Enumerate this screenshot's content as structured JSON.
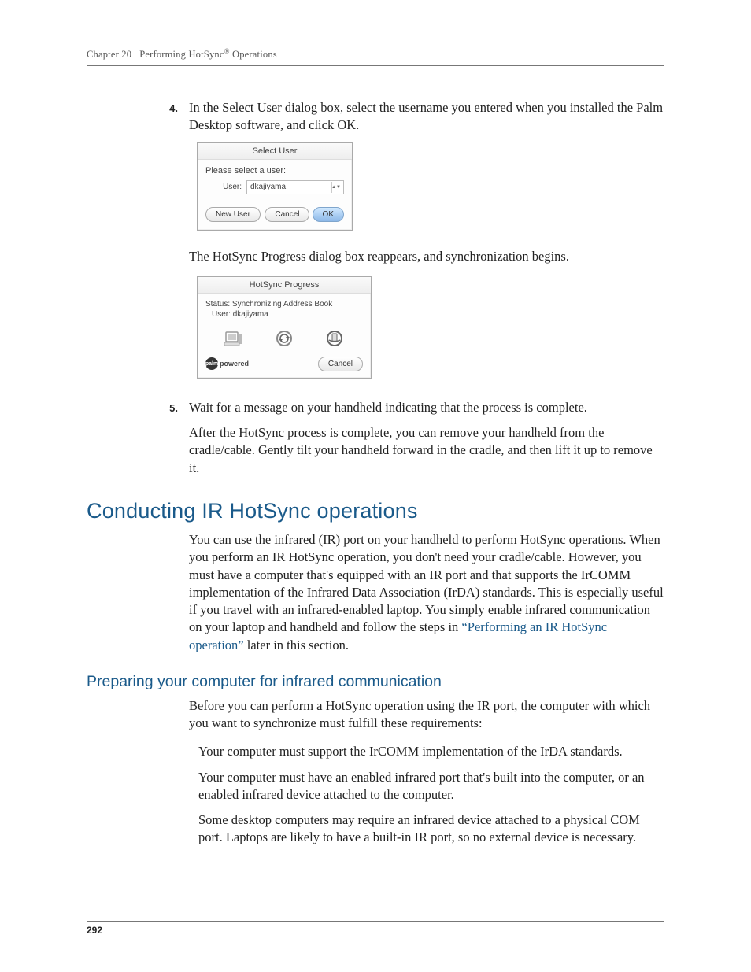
{
  "header": {
    "chapter_label": "Chapter 20",
    "chapter_title": "Performing HotSync",
    "chapter_title_suffix": " Operations"
  },
  "step4": {
    "number": "4.",
    "text": "In the Select User dialog box, select the username you entered when you installed the Palm Desktop software, and click OK."
  },
  "select_user_dialog": {
    "title": "Select User",
    "prompt": "Please select a user:",
    "user_label": "User:",
    "user_value": "dkajiyama",
    "new_user_btn": "New User",
    "cancel_btn": "Cancel",
    "ok_btn": "OK"
  },
  "after_select_user": "The HotSync Progress dialog box reappears, and synchronization begins.",
  "hotsync_dialog": {
    "title": "HotSync Progress",
    "status_label": "Status:",
    "status_value": "Synchronizing Address Book",
    "user_label": "User:",
    "user_value": "dkajiyama",
    "powered_text": "powered",
    "palm_text": "palm",
    "cancel_btn": "Cancel"
  },
  "step5": {
    "number": "5.",
    "text": "Wait for a message on your handheld indicating that the process is complete.",
    "followup": "After the HotSync process is complete, you can remove your handheld from the cradle/cable. Gently tilt your handheld forward in the cradle, and then lift it up to remove it."
  },
  "section_heading": "Conducting IR HotSync operations",
  "section_para_before_link": "You can use the infrared (IR) port on your handheld to perform HotSync operations. When you perform an IR HotSync operation, you don't need your cradle/cable. However, you must have a computer that's equipped with an IR port and that supports the IrCOMM implementation of the Infrared Data Association (IrDA) standards. This is especially useful if you travel with an infrared-enabled laptop. You simply enable infrared communication on your laptop and handheld and follow the steps in ",
  "section_link_text": "“Performing an IR HotSync operation”",
  "section_para_after_link": " later in this section.",
  "subsection_heading": "Preparing your computer for infrared communication",
  "subsection_intro": "Before you can perform a HotSync operation using the IR port, the computer with which you want to synchronize must fulfill these requirements:",
  "requirements": [
    "Your computer must support the IrCOMM implementation of the IrDA standards.",
    "Your computer must have an enabled infrared port that's built into the computer, or an enabled infrared device attached to the computer.",
    "Some desktop computers may require an infrared device attached to a physical COM port. Laptops are likely to have a built-in IR port, so no external device is necessary."
  ],
  "page_number": "292"
}
